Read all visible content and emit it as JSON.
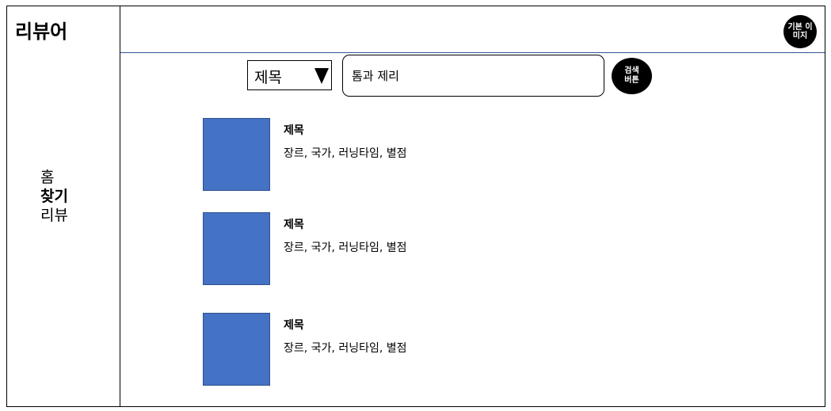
{
  "app": {
    "title": "리뷰어"
  },
  "sidebar": {
    "items": [
      {
        "label": "홈",
        "active": false
      },
      {
        "label": "찾기",
        "active": true
      },
      {
        "label": "리뷰",
        "active": false
      }
    ]
  },
  "header": {
    "avatar_label": "기본 이미지"
  },
  "search": {
    "filter_selected": "제목",
    "query": "톰과 제리",
    "button_label": "검색 버튼"
  },
  "results": [
    {
      "title": "제목",
      "meta": "장르, 국가, 러닝타임, 별점"
    },
    {
      "title": "제목",
      "meta": "장르, 국가, 러닝타임, 별점"
    },
    {
      "title": "제목",
      "meta": "장르, 국가, 러닝타임, 별점"
    }
  ],
  "colors": {
    "thumbnail": "#4472c4",
    "header_divider": "#2f5597",
    "accent": "#000000"
  }
}
